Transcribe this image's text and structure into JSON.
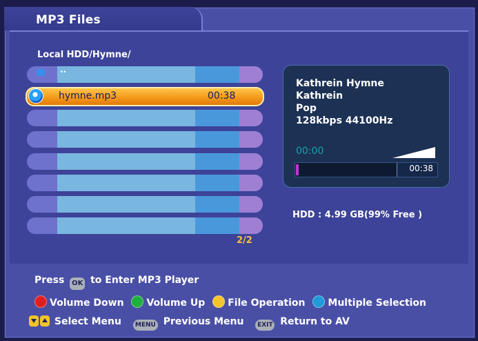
{
  "window": {
    "tab_title": "MP3 Files",
    "path": "Local HDD/Hymne/"
  },
  "file_list": {
    "parent_entry": "..",
    "selected": {
      "name": "hymne.mp3",
      "duration": "00:38"
    },
    "page_indicator": "2/2"
  },
  "info_panel": {
    "title": "Kathrein Hymne",
    "artist": "Kathrein",
    "genre": "Pop",
    "bitrate": "128kbps 44100Hz",
    "elapsed": "00:00",
    "duration": "00:38",
    "progress": 0.0
  },
  "hdd_status": "HDD : 4.99 GB(99% Free )",
  "help": {
    "press": "Press",
    "ok_key": "OK",
    "enter_player": "to Enter MP3 Player",
    "red_label": "Volume Down",
    "green_label": "Volume Up",
    "yellow_label": "File Operation",
    "blue_label": "Multiple Selection",
    "select_menu": "Select Menu",
    "menu_key": "MENU",
    "previous_menu": "Previous Menu",
    "exit_key": "EXIT",
    "return_av": "Return to AV"
  },
  "colors": {
    "red": "#e02020",
    "green": "#20b040",
    "yellow": "#f4c42a",
    "blue": "#1e9bd8",
    "highlight": "#f59a1a"
  }
}
